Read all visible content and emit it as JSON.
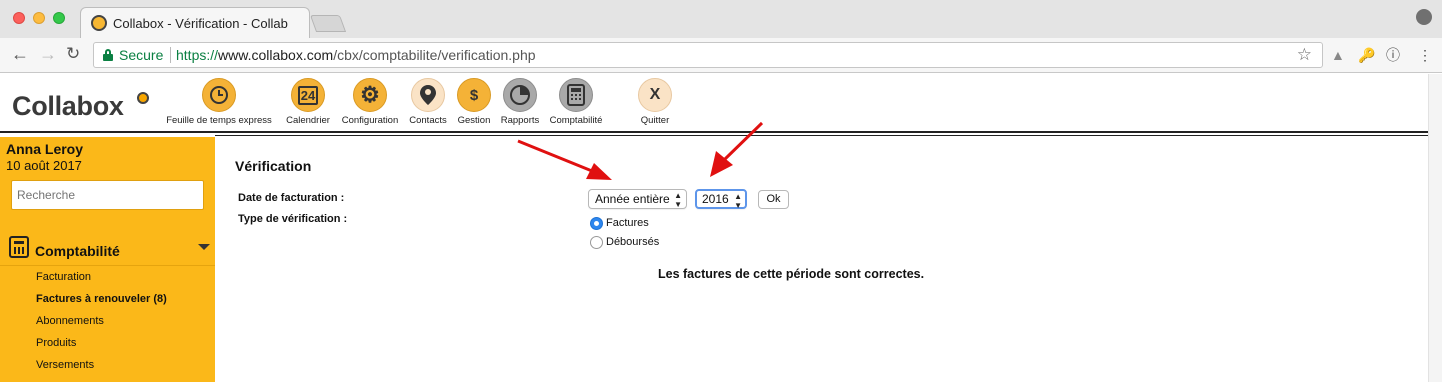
{
  "browser": {
    "tab_title": "Collabox - Vérification - Collab",
    "secure_label": "Secure",
    "url_scheme": "https://",
    "url_host": "www.collabox.com",
    "url_path": "/cbx/comptabilite/verification.php"
  },
  "app": {
    "logo": "Collabox",
    "nav": [
      {
        "label": "Feuille de temps express",
        "icon": "clock-icon"
      },
      {
        "label": "Calendrier",
        "icon": "calendar-icon",
        "glyph": "24"
      },
      {
        "label": "Configuration",
        "icon": "gear-icon"
      },
      {
        "label": "Contacts",
        "icon": "contact-pin-icon"
      },
      {
        "label": "Gestion",
        "icon": "money-tag-icon"
      },
      {
        "label": "Rapports",
        "icon": "pie-chart-icon"
      },
      {
        "label": "Comptabilité",
        "icon": "calculator-icon"
      },
      {
        "label": "Quitter",
        "icon": "quit-icon",
        "glyph": "X"
      }
    ]
  },
  "sidebar": {
    "user_name": "Anna Leroy",
    "date": "10 août 2017",
    "search_placeholder": "Recherche",
    "section_label": "Comptabilité",
    "items": [
      {
        "label": "Facturation"
      },
      {
        "label": "Factures à renouveler (8)"
      },
      {
        "label": "Abonnements"
      },
      {
        "label": "Produits"
      },
      {
        "label": "Versements"
      }
    ]
  },
  "main": {
    "title": "Vérification",
    "date_label": "Date de facturation :",
    "type_label": "Type de vérification :",
    "period_select": "Année entière",
    "year_select": "2016",
    "ok_label": "Ok",
    "radio_factures": "Factures",
    "radio_debourses": "Déboursés",
    "result": "Les factures de cette période sont correctes."
  },
  "colors": {
    "sidebar_bg": "#fbb819",
    "nav_icon_orange": "#f4b237",
    "nav_icon_gray": "#a9a9a9",
    "annotation_arrow": "#e01010",
    "radio_selected": "#2d86ee"
  }
}
